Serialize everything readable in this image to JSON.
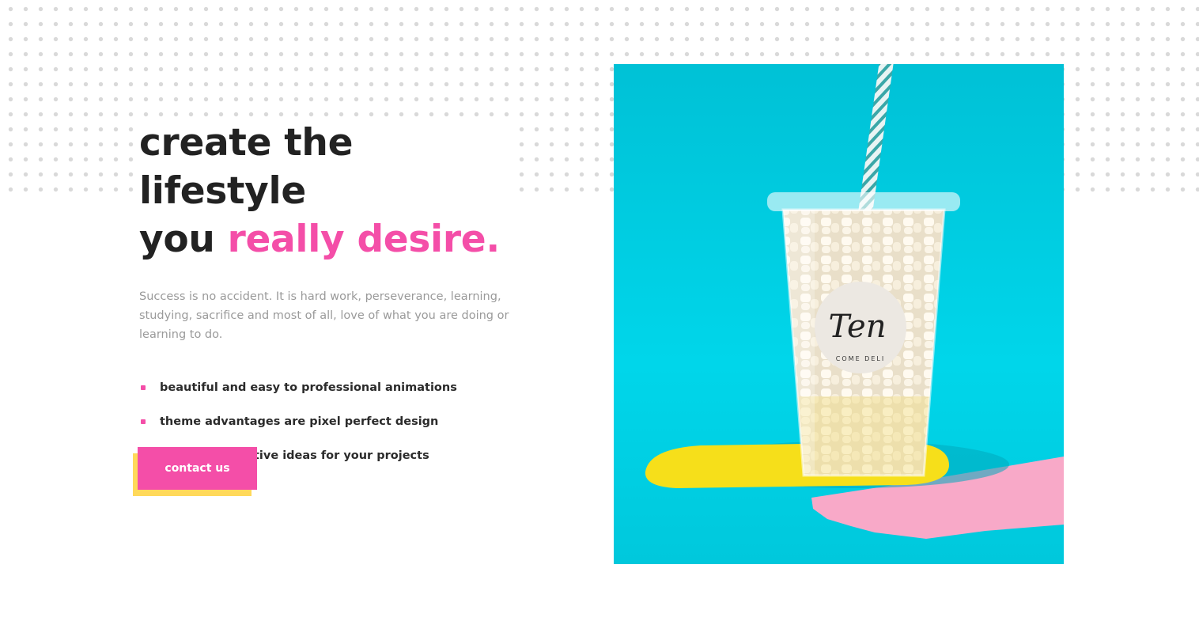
{
  "hero": {
    "headline_line1": "create the lifestyle",
    "headline_line2_prefix": "you ",
    "headline_line2_accent": "really desire.",
    "intro": "Success is no accident. It is hard work, perseverance, learning, studying, sacrifice and most of all, love of what you are doing or learning to do.",
    "features": [
      {
        "label": "beautiful and easy to professional animations"
      },
      {
        "label": "theme advantages are pixel perfect design"
      },
      {
        "label": "find more creative ideas for your projects"
      }
    ],
    "cta_label": "contact us"
  },
  "photo": {
    "cup_brand": "Ten",
    "cup_subtext": "COME DELI"
  },
  "colors": {
    "accent_pink": "#f44ea8",
    "accent_yellow": "#ffd95a",
    "text_dark": "#222222",
    "text_muted": "#9a9a9a",
    "photo_background": "#00c8dc"
  }
}
